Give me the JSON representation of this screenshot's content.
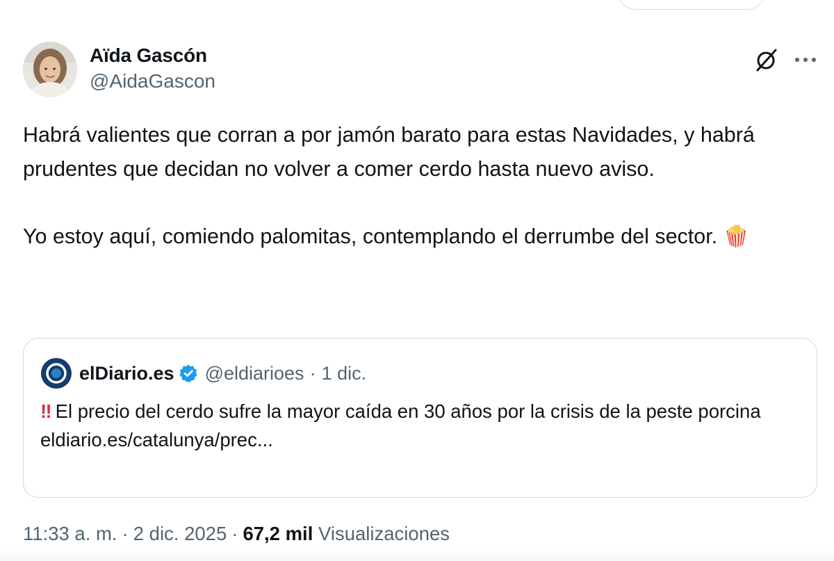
{
  "author": {
    "display_name": "Aïda Gascón",
    "handle": "@AidaGascon",
    "avatar": "profile-photo"
  },
  "icons": {
    "grok": "grok-slash-icon",
    "more": "more-dots-icon"
  },
  "tweet": {
    "paragraph1": "Habrá valientes que corran a por jamón barato para estas Navidades, y habrá prudentes que decidan no volver a comer cerdo hasta nuevo aviso.",
    "paragraph2": "Yo estoy aquí, comiendo palomitas, contemplando el derrumbe del sector.",
    "emoji": "🍿"
  },
  "quote": {
    "name": "elDiario.es",
    "verified": true,
    "handle": "@eldiarioes",
    "separator": "·",
    "date": "1 dic.",
    "prefix_emoji": "‼",
    "text": "El precio del cerdo sufre la mayor caída en 30 años por la crisis de la peste porcina",
    "link": "eldiario.es/catalunya/prec..."
  },
  "meta": {
    "time": "11:33 a. m.",
    "separator": "·",
    "date": "2 dic. 2025",
    "views_count": "67,2 mil",
    "views_label": "Visualizaciones"
  },
  "colors": {
    "text_primary": "#0f1419",
    "text_secondary": "#536471",
    "border": "#cfd9de",
    "verified_blue": "#1d9bf0",
    "eldiario_navy": "#143c6c"
  }
}
